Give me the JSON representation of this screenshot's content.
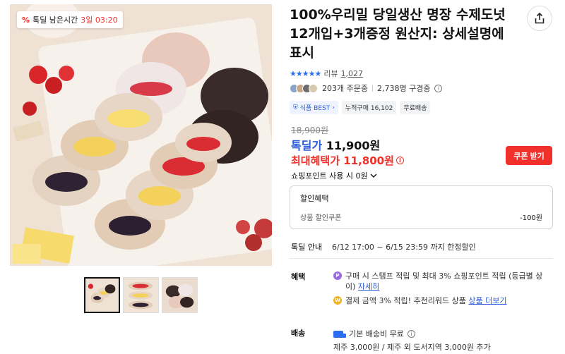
{
  "timer": {
    "icon": "percent-icon",
    "label": "톡딜 남은시간",
    "value": "3일 03:20"
  },
  "product": {
    "title": "100%우리밀 당일생산 명장 수제도넛 12개입+3개증정 원산지: 상세설명에 표시",
    "rating_stars": "★★★★★",
    "review_label": "리뷰",
    "review_count": "1,027",
    "orders": "203개 주문중",
    "subscribers": "2,738명 구경중",
    "tags": {
      "best": "식품 BEST",
      "cumulative": "누적구매 16,102",
      "free_ship": "무료배송"
    }
  },
  "price": {
    "original": "18,900원",
    "deal_label": "톡딜가",
    "deal_price": "11,900원",
    "max_benefit": "최대혜택가 11,800원",
    "coupon_button": "쿠폰 받기",
    "points_text": "쇼핑포인트 사용 시 0원"
  },
  "discount": {
    "title": "할인혜택",
    "item_label": "상품 할인쿠폰",
    "item_amount": "-100원"
  },
  "deal_info": {
    "label": "톡딜 안내",
    "value": "6/12 17:00 ~ 6/15 23:59 까지 한정할인"
  },
  "benefits": {
    "label": "혜택",
    "item1_text": "구매 시 스탬프 적립 및 최대 3% 쇼핑포인트 적립 (등급별 상이)",
    "item1_link": "자세히",
    "item2_text": "결제 금액 3% 적립! 추천리워드 상품",
    "item2_link": "상품 더보기"
  },
  "shipping": {
    "label": "배송",
    "line1": "기본 배송비 무료",
    "line2": "제주 3,000원 / 제주 외 도서지역 3,000원 추가"
  },
  "colors": {
    "accent_blue": "#2a5bd7",
    "accent_red": "#f0312b"
  }
}
